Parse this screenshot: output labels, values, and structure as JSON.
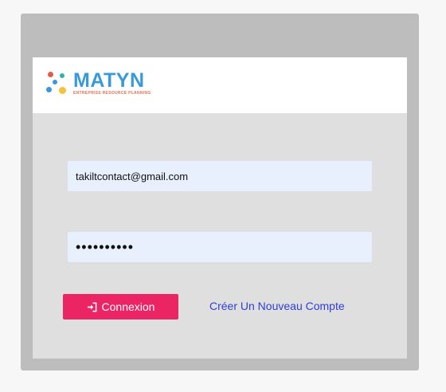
{
  "logo": {
    "name": "MATYN",
    "tagline": "ENTREPRISE RESOURCE PLANNING",
    "icon": "molecule-dots-icon",
    "name_color": "#3a9ad9",
    "tagline_color": "#e2735a",
    "dot_colors": [
      "#e25c4a",
      "#2bb3b1",
      "#3a9ad9",
      "#f5c33b"
    ]
  },
  "form": {
    "email_value": "takiltcontact@gmail.com",
    "password_value": "••••••••••",
    "login_label": "Connexion",
    "login_icon": "sign-in-icon",
    "create_account_label": "Créer Un Nouveau Compte"
  },
  "colors": {
    "primary_button": "#eb2463",
    "link": "#2d3fd8",
    "input_background": "#e8f0fe"
  }
}
